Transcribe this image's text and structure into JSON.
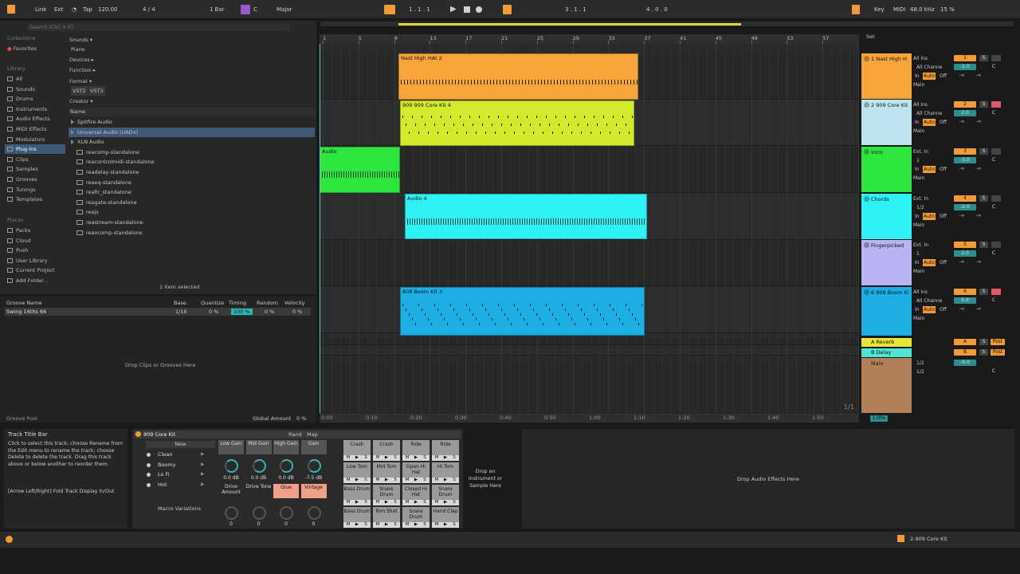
{
  "toolbar": {
    "link": "Link",
    "ext": "Ext",
    "tap": "Tap",
    "tempo": "120.00",
    "sig": "4 / 4",
    "loop": "1 Bar",
    "key_root": "C",
    "scale": "Major",
    "pos1": "1 .  1 .  1",
    "pos2": "3 .  1 .  1",
    "pos3": "4 .  0 .  0",
    "key": "Key",
    "midi": "MIDI",
    "rate": "48.0 kHz",
    "cpu": "15 %"
  },
  "browser": {
    "search_placeholder": "Search (Ctrl + F)",
    "collections_header": "Collections",
    "favorites": "Favorites",
    "library_header": "Library",
    "library": [
      "All",
      "Sounds",
      "Drums",
      "Instruments",
      "Audio Effects",
      "MIDI Effects",
      "Modulators",
      "Plug-Ins",
      "Clips",
      "Samples",
      "Grooves",
      "Tunings",
      "Templates"
    ],
    "places_header": "Places",
    "places": [
      "Packs",
      "Cloud",
      "Push",
      "User Library",
      "Current Project",
      "Add Folder..."
    ],
    "filters": [
      "Sounds ▾",
      "Piano",
      "Devices ▸",
      "Function ▸",
      "Format ▾",
      "VST2",
      "VST3",
      "Creator ▾"
    ],
    "name_col": "Name",
    "items": [
      "Spitfire Audio",
      "Universal Audio (UADx)",
      "XLN Audio",
      "reacomp-standalone",
      "reacontrolmidi-standalone",
      "readelay-standalone",
      "reaeq-standalone",
      "reafir_standalone",
      "reagate-standalone",
      "reajs",
      "reastream-standalone",
      "reaxcomp-standalone"
    ],
    "status": "1 item selected"
  },
  "groove": {
    "headers": [
      "Groove Name",
      "Base",
      "Quantize",
      "Timing",
      "Random",
      "Velocity"
    ],
    "row": {
      "name": "Swing 16ths 66",
      "base": "1/16",
      "quantize": "0 %",
      "timing": "100 %",
      "random": "0 %",
      "velocity": "0 %"
    },
    "drop": "Drop Clips or Grooves Here",
    "pool": "Groove Pool",
    "global_label": "Global Amount",
    "global": "0 %"
  },
  "ruler": {
    "bars": [
      "1",
      "5",
      "9",
      "13",
      "17",
      "21",
      "25",
      "29",
      "33",
      "37",
      "41",
      "45",
      "49",
      "53",
      "57"
    ],
    "times": [
      "0:00",
      "0:10",
      "0:20",
      "0:30",
      "0:40",
      "0:50",
      "1:00",
      "1:10",
      "1:20",
      "1:30",
      "1:40",
      "1:50"
    ],
    "page": "1/1"
  },
  "clips": [
    {
      "name": "Nast High HAt 2",
      "color": "#f7a43a"
    },
    {
      "name": "909 909 Core Kit 4",
      "color": "#d2ea2b"
    },
    {
      "name": "Audio",
      "color": "#2ee63e"
    },
    {
      "name": "Audio 4",
      "color": "#2ef0f5"
    },
    {
      "name": "808 Boom Kit 3",
      "color": "#1eaee6"
    }
  ],
  "tracks": [
    {
      "name": "1 Nast High H",
      "color": "#f7a43a",
      "in": "All Ins",
      "ch": "All Channe",
      "out": "Main",
      "num": "1",
      "vol": "-1.0",
      "pan": "C"
    },
    {
      "name": "2 909 Core Kit",
      "color": "#bfe3ef",
      "in": "All Ins",
      "ch": "All Channe",
      "out": "Main",
      "num": "2",
      "vol": "2.0",
      "pan": "C"
    },
    {
      "name": "Intro",
      "color": "#2ee63e",
      "in": "Ext. In",
      "ch": "1",
      "out": "Main",
      "num": "3",
      "vol": "-3.0",
      "pan": "C"
    },
    {
      "name": "Chords",
      "color": "#2ef0f5",
      "in": "Ext. In",
      "ch": "1/2",
      "out": "Main",
      "num": "4",
      "vol": "-2.0",
      "pan": "C"
    },
    {
      "name": "Fingerpicked",
      "color": "#b8b3f2",
      "in": "Ext. In",
      "ch": "1",
      "out": "Main",
      "num": "5",
      "vol": "2.0",
      "pan": "C"
    },
    {
      "name": "6 808 Boom Ki",
      "color": "#1eaee6",
      "in": "All Ins",
      "ch": "All Channe",
      "out": "Main",
      "num": "6",
      "vol": "5.9",
      "pan": "C"
    }
  ],
  "returns": [
    {
      "name": "A Reverb",
      "letter": "A",
      "color": "#e6e63a"
    },
    {
      "name": "B Delay",
      "letter": "B",
      "color": "#4ee6d2"
    }
  ],
  "main": {
    "name": "Main",
    "out1": "1/2",
    "out2": "1/2",
    "vol": "-6.0",
    "zoom": "1.00x",
    "set": "Set"
  },
  "mon": {
    "in": "In",
    "auto": "Auto",
    "off": "Off",
    "solo": "S",
    "post": "Post",
    "inf": "-∞"
  },
  "info": {
    "title": "Track Title Bar",
    "body": "Click to select this track; choose Rename from the Edit menu to rename the track; choose Delete to delete the track. Drag this track above or below another to reorder them.",
    "hint": "[Arrow Left/Right] Fold Track Display In/Out"
  },
  "rack": {
    "title": "909 Core Kit",
    "rand": "Rand",
    "map": "Map",
    "new": "New",
    "variations": [
      "Clean",
      "Boomy",
      "Lo Fi",
      "Hot"
    ],
    "macro_var": "Macro Variations",
    "macros": [
      {
        "name": "Low Gain",
        "val": "0.0 dB"
      },
      {
        "name": "Mid Gain",
        "val": "0.0 dB"
      },
      {
        "name": "High Gain",
        "val": "0.0 dB"
      },
      {
        "name": "Gain",
        "val": "-7.5 dB"
      },
      {
        "name": "Drive Amount",
        "val": "0"
      },
      {
        "name": "Drive Tone",
        "val": "0"
      },
      {
        "name": "Glue",
        "val": "0"
      },
      {
        "name": "Vintage",
        "val": "0"
      }
    ],
    "pads": [
      "Crash",
      "Crash",
      "Ride",
      "Ride",
      "Low Tom",
      "Mid Tom",
      "Open Hi Hat",
      "Hi Tom",
      "Bass Drum",
      "Snare Drum",
      "Closed Hi Hat",
      "Snare Drum",
      "Bass Drum",
      "Rim Shot",
      "Snare Drum",
      "Hand Clap"
    ],
    "pad_btns": [
      "M",
      "▶",
      "S"
    ],
    "drop_inst": "Drop an Instrument or Sample Here",
    "drop_fx": "Drop Audio Effects Here"
  },
  "status": {
    "track": "2-909 Core Kit"
  }
}
